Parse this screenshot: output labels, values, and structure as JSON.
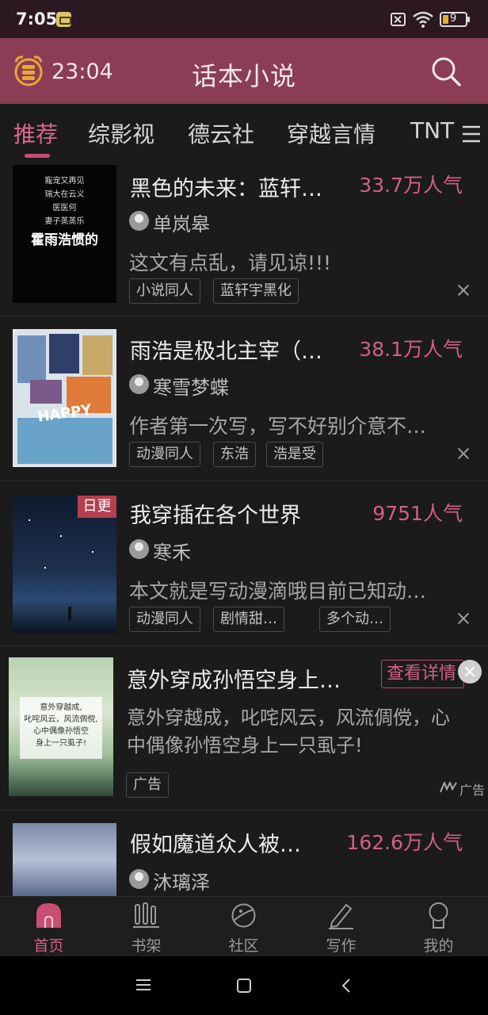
{
  "status_bar": {
    "time": "7:05",
    "battery": "9"
  },
  "header": {
    "timer": "23:04",
    "title": "话本小说"
  },
  "tabs": [
    {
      "label": "推荐"
    },
    {
      "label": "综影视"
    },
    {
      "label": "德云社"
    },
    {
      "label": "穿越言情"
    },
    {
      "label": "TNT"
    }
  ],
  "books": [
    {
      "title": "黑色的未来：蓝轩…",
      "popularity": "33.7万人气",
      "author": "单岚皋",
      "desc": "这文有点乱，请见谅!!!",
      "tags": [
        "小说同人",
        "蓝轩宇黑化"
      ],
      "cover_lines": [
        "寵宠又再见",
        "瑞大在云义",
        "医医何",
        "妻子蒸蒸乐"
      ],
      "cover_title": "霍雨浩惯的"
    },
    {
      "title": "雨浩是极北主宰（…",
      "popularity": "38.1万人气",
      "author": "寒雪梦蝶",
      "desc": "作者第一次写，写不好别介意不…",
      "tags": [
        "动漫同人",
        "东浩",
        "浩是受"
      ],
      "cover_text": "HAPPY"
    },
    {
      "title": "我穿插在各个世界",
      "popularity": "9751人气",
      "author": "寒禾",
      "desc": "本文就是写动漫滴哦目前已知动…",
      "tags": [
        "动漫同人",
        "剧情甜…",
        "多个动…"
      ],
      "badge": "日更"
    },
    {
      "title": "假如魔道众人被…",
      "popularity": "162.6万人气",
      "author": "沐璃泽"
    }
  ],
  "ad": {
    "title": "意外穿成孙悟空身上…",
    "detail_button": "查看详情",
    "desc": "意外穿越成，叱咤风云，风流倜傥，心中偶像孙悟空身上一只虱子!",
    "tag": "广告",
    "ad_label": "广告",
    "cover_lines": [
      "意外穿越成,",
      "叱咤风云，风流倜傥,",
      "心中偶像孙悟空",
      "身上一只虱子!"
    ]
  },
  "bottom_nav": [
    {
      "label": "首页"
    },
    {
      "label": "书架"
    },
    {
      "label": "社区"
    },
    {
      "label": "写作"
    },
    {
      "label": "我的"
    }
  ],
  "colors": {
    "accent": "#d45f84",
    "header_bg": "#8b3d55",
    "background": "#1b1b1b"
  }
}
